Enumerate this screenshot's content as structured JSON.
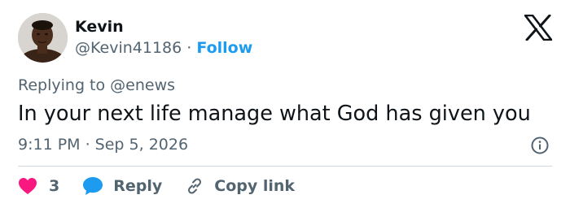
{
  "author": {
    "name": "Kevin",
    "handle": "@Kevin41186",
    "separator": "·",
    "follow_label": "Follow"
  },
  "header": {
    "logo_icon": "x-logo-icon"
  },
  "tweet": {
    "replying_to": "Replying to @enews",
    "text": "In your next life manage what God has given you",
    "timestamp": "9:11 PM · Sep 5, 2026"
  },
  "actions": {
    "like_count": "3",
    "reply_label": "Reply",
    "copy_link_label": "Copy link"
  },
  "colors": {
    "link": "#1d9bf0",
    "like": "#f91880",
    "reply_bubble": "#1d9bf0",
    "muted": "#536471",
    "text": "#0f1419",
    "divider": "#cfd9de"
  }
}
